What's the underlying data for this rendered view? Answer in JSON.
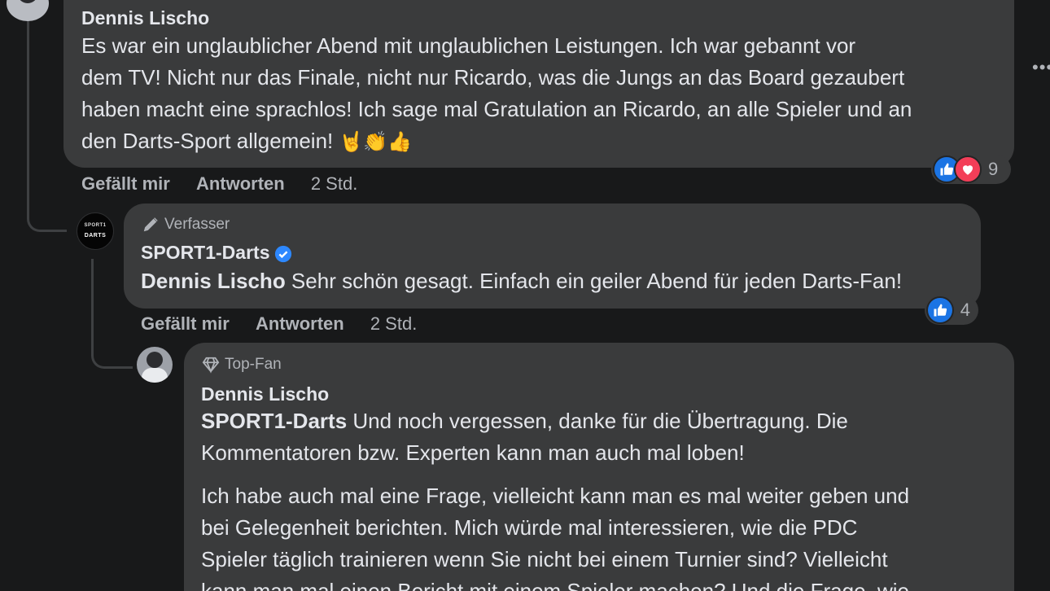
{
  "comment1": {
    "author": "Dennis Lischo",
    "lines": [
      "Es war ein unglaublicher Abend mit unglaublichen Leistungen. Ich war gebannt vor",
      "dem TV! Nicht nur das Finale, nicht nur Ricardo, was die Jungs an das Board gezaubert",
      "haben macht eine sprachlos! Ich sage mal Gratulation an Ricardo, an alle Spieler und an",
      "den Darts-Sport allgemein! "
    ],
    "emojis": "🤘👏👍",
    "like_label": "Gefällt mir",
    "reply_label": "Antworten",
    "time": "2 Std.",
    "reaction_count": "9",
    "reactions": [
      "like-icon",
      "love-icon"
    ]
  },
  "comment2": {
    "badge": "Verfasser",
    "author": "SPORT1-Darts",
    "verified": true,
    "mention": "Dennis Lischo",
    "text": " Sehr schön gesagt. Einfach ein geiler Abend für jeden Darts-Fan!",
    "like_label": "Gefällt mir",
    "reply_label": "Antworten",
    "time": "2 Std.",
    "reaction_count": "4",
    "reactions": [
      "like-icon"
    ]
  },
  "comment3": {
    "badge": "Top-Fan",
    "author": "Dennis Lischo",
    "mention": "SPORT1-Darts",
    "line1_rest": " Und noch vergessen, danke für die Übertragung. Die",
    "line2": "Kommentatoren bzw. Experten kann man auch mal loben!",
    "para2": [
      "Ich habe auch mal eine Frage, vielleicht kann man es mal weiter geben und",
      "bei Gelegenheit berichten. Mich würde mal interessieren, wie die PDC",
      "Spieler täglich trainieren wenn Sie nicht bei einem Turnier sind? Vielleicht",
      "kann man mal einen Bericht mit einem Spieler machen? Und die Frage, wie"
    ]
  },
  "sport1_avatar": {
    "line1": "SPORT1",
    "line2": "DARTS"
  },
  "more_menu": "•••"
}
